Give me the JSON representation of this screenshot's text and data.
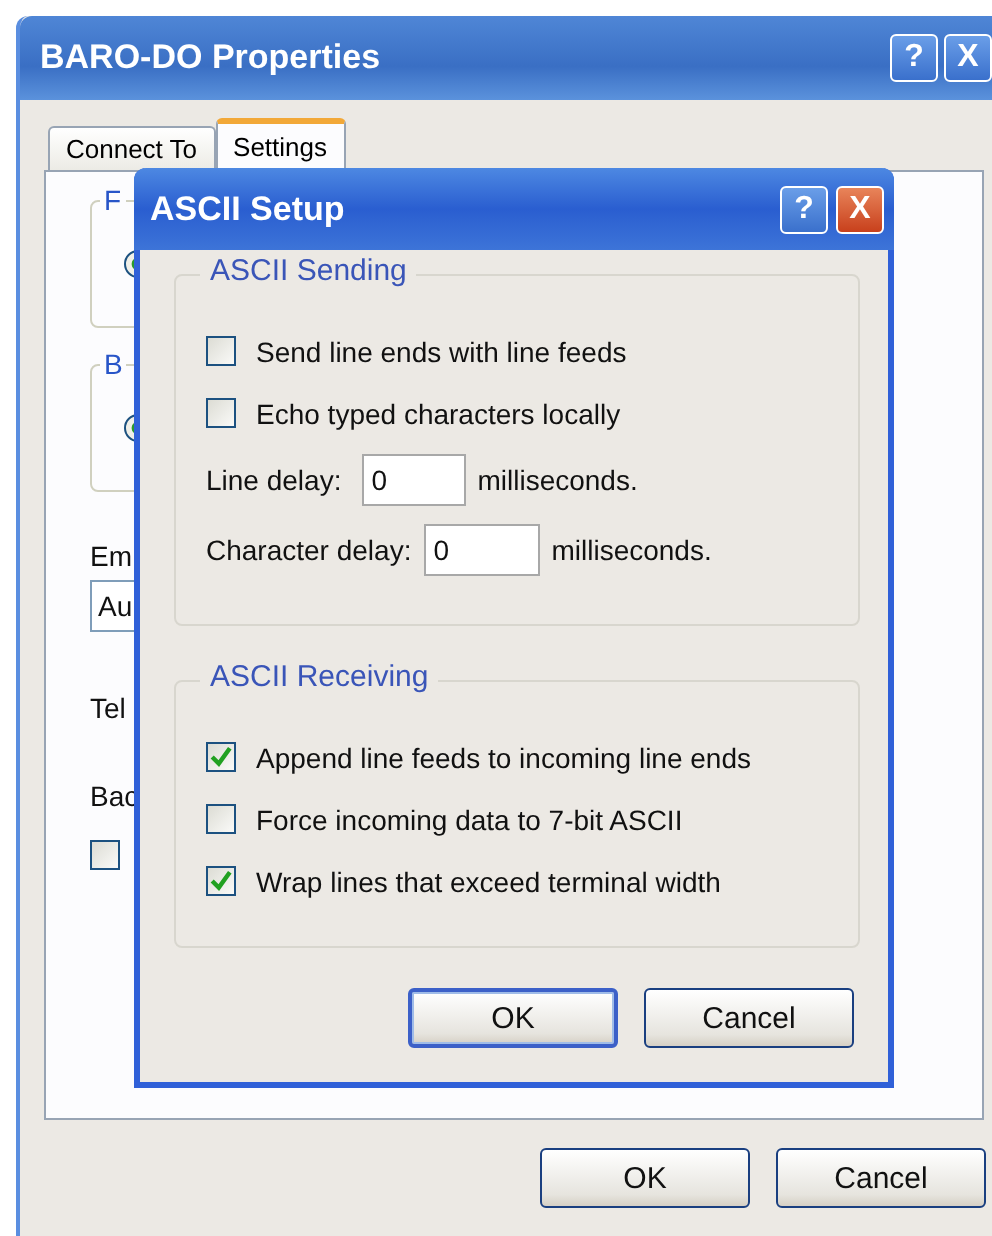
{
  "window": {
    "title": "BARO-DO Properties",
    "help_glyph": "?",
    "close_glyph": "X"
  },
  "tabs": [
    {
      "label": "Connect To",
      "selected": false
    },
    {
      "label": "Settings",
      "selected": true
    }
  ],
  "settings_panel": {
    "group_1_label": "F",
    "group_2_label": "B",
    "label_1": "Em",
    "combo_value": "Au",
    "label_2": "Tel",
    "label_3": "Bac",
    "checkbox_checked": false,
    "radios": [
      {
        "selected": true
      },
      {
        "selected": true
      }
    ]
  },
  "buttons": [
    {
      "label": "OK",
      "default": false
    },
    {
      "label": "Cancel",
      "default": false
    }
  ],
  "dialog": {
    "title": "ASCII Setup",
    "help_glyph": "?",
    "close_glyph": "X",
    "sending": {
      "label": "ASCII Sending",
      "options": [
        {
          "label": "Send line ends with line feeds",
          "checked": false
        },
        {
          "label": "Echo typed characters locally",
          "checked": false
        }
      ],
      "fields": [
        {
          "label": "Line delay:",
          "value": "0",
          "unit": "milliseconds."
        },
        {
          "label": "Character delay:",
          "value": "0",
          "unit": "milliseconds."
        }
      ]
    },
    "receiving": {
      "label": "ASCII Receiving",
      "options": [
        {
          "label": "Append line feeds to incoming line ends",
          "checked": true
        },
        {
          "label": "Force incoming data to 7-bit ASCII",
          "checked": false
        },
        {
          "label": "Wrap lines that exceed terminal width",
          "checked": true
        }
      ]
    },
    "buttons": [
      {
        "label": "OK",
        "default": true
      },
      {
        "label": "Cancel",
        "default": false
      }
    ]
  }
}
